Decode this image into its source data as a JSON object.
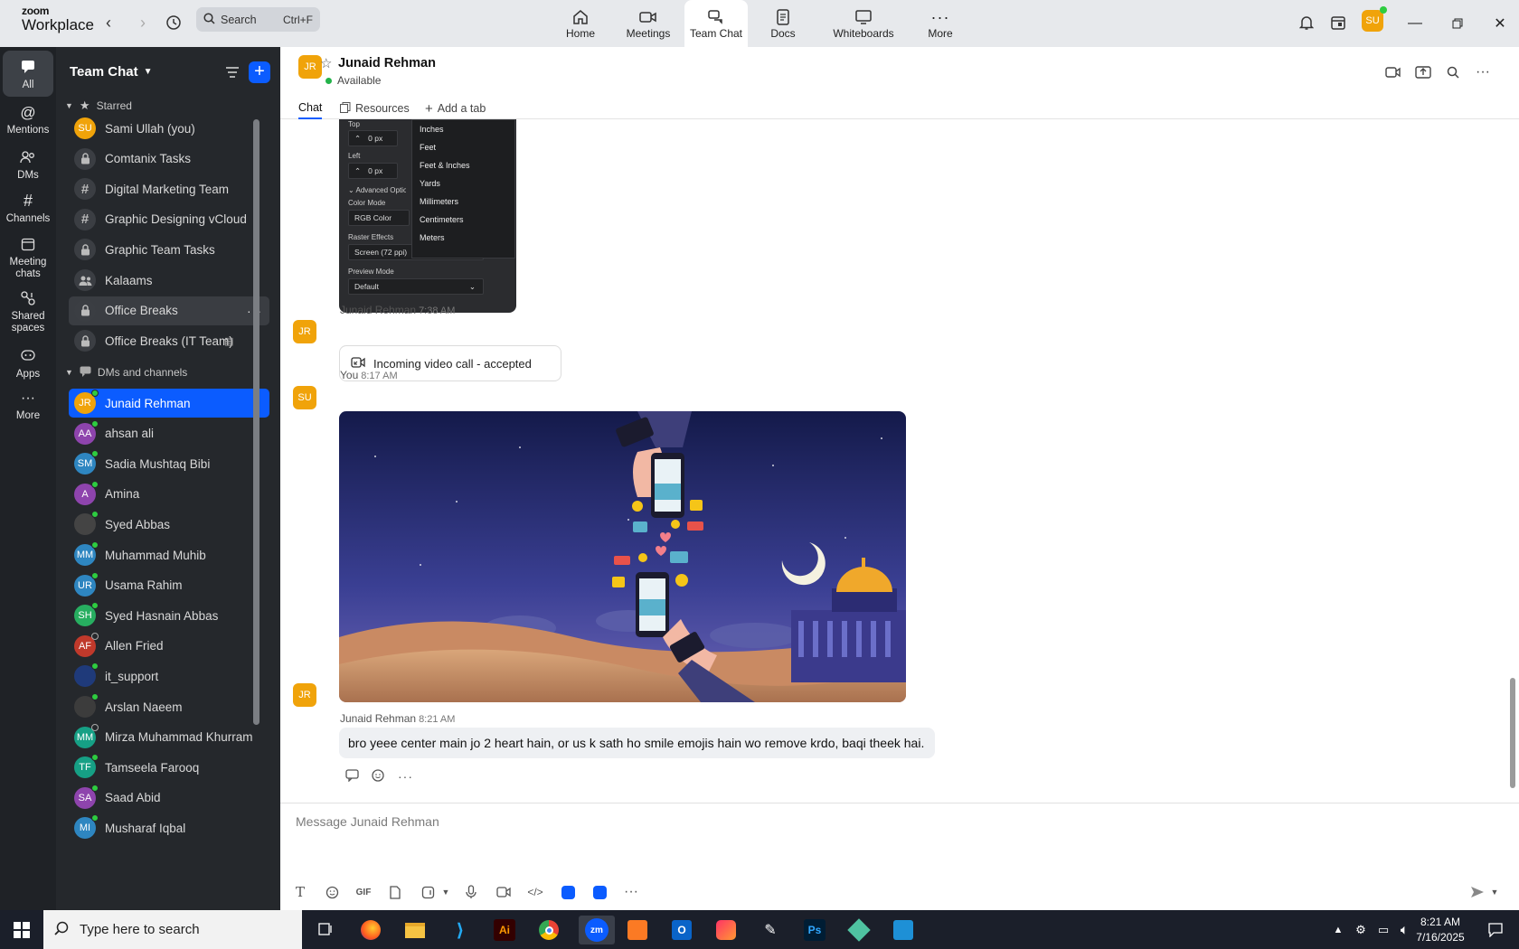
{
  "brand": {
    "line1": "zoom",
    "line2": "Workplace"
  },
  "search": {
    "placeholder": "Search",
    "shortcut": "Ctrl+F"
  },
  "nav": [
    {
      "label": "Home"
    },
    {
      "label": "Meetings"
    },
    {
      "label": "Team Chat"
    },
    {
      "label": "Docs"
    },
    {
      "label": "Whiteboards"
    },
    {
      "label": "More"
    }
  ],
  "user": {
    "initials": "SU",
    "color": "#f0a30a"
  },
  "rail": [
    {
      "label": "All"
    },
    {
      "label": "Mentions"
    },
    {
      "label": "DMs"
    },
    {
      "label": "Channels"
    },
    {
      "label": "Meeting chats"
    },
    {
      "label": "Shared spaces"
    },
    {
      "label": "Apps"
    },
    {
      "label": "More"
    }
  ],
  "sidebar": {
    "title": "Team Chat",
    "starred_label": "Starred",
    "dms_label": "DMs and channels",
    "starred": [
      {
        "label": "Sami Ullah (you)",
        "icon": "avatar",
        "initials": "SU",
        "color": "#f0a30a"
      },
      {
        "label": "Comtanix Tasks",
        "icon": "lock-icon"
      },
      {
        "label": "Digital Marketing Team",
        "icon": "hash-icon"
      },
      {
        "label": "Graphic Designing vCloud",
        "icon": "hash-icon"
      },
      {
        "label": "Graphic Team Tasks",
        "icon": "lock-icon"
      },
      {
        "label": "Kalaams",
        "icon": "group-icon"
      },
      {
        "label": "Office Breaks",
        "icon": "lock-icon"
      },
      {
        "label": "Office Breaks (IT Team)",
        "icon": "lock-icon"
      }
    ],
    "dms": [
      {
        "label": "Junaid Rehman",
        "initials": "JR",
        "color": "#f0a30a",
        "status": "online"
      },
      {
        "label": "ahsan ali",
        "initials": "AA",
        "color": "#8e44ad",
        "status": "online"
      },
      {
        "label": "Sadia Mushtaq Bibi",
        "initials": "SM",
        "color": "#2e86c1",
        "status": "online"
      },
      {
        "label": "Amina",
        "initials": "A",
        "color": "#8e44ad",
        "status": "online"
      },
      {
        "label": "Syed Abbas",
        "initials": "",
        "color": "#444444",
        "status": "online"
      },
      {
        "label": "Muhammad Muhib",
        "initials": "MM",
        "color": "#2e86c1",
        "status": "online"
      },
      {
        "label": "Usama Rahim",
        "initials": "UR",
        "color": "#2e86c1",
        "status": "online"
      },
      {
        "label": "Syed Hasnain Abbas",
        "initials": "SH",
        "color": "#27ae60",
        "status": "online"
      },
      {
        "label": "Allen Fried",
        "initials": "AF",
        "color": "#c0392b",
        "status": "away"
      },
      {
        "label": "it_support",
        "initials": "",
        "color": "#1f3a7a",
        "status": "online"
      },
      {
        "label": "Arslan Naeem",
        "initials": "",
        "color": "#3c3c3c",
        "status": "online"
      },
      {
        "label": "Mirza Muhammad Khurram",
        "initials": "MM",
        "color": "#16a085",
        "status": "away"
      },
      {
        "label": "Tamseela Farooq",
        "initials": "TF",
        "color": "#16a085",
        "status": "online"
      },
      {
        "label": "Saad Abid",
        "initials": "SA",
        "color": "#8e44ad",
        "status": "online"
      },
      {
        "label": "Musharaf Iqbal",
        "initials": "MI",
        "color": "#2e86c1",
        "status": "online"
      }
    ]
  },
  "channel": {
    "name": "Junaid Rehman",
    "initials": "JR",
    "status": "Available",
    "tabs": [
      {
        "label": "Chat"
      },
      {
        "label": "Resources"
      },
      {
        "label": "Add a tab"
      }
    ]
  },
  "screenshot": {
    "top_label": "Top",
    "top_value": "0 px",
    "left_label": "Left",
    "left_value": "0 px",
    "advanced": "Advanced Options",
    "color_mode_label": "Color Mode",
    "color_mode": "RGB Color",
    "raster_label": "Raster Effects",
    "raster": "Screen (72 ppi)",
    "preview_label": "Preview Mode",
    "preview": "Default",
    "units": [
      "Inches",
      "Feet",
      "Feet & Inches",
      "Yards",
      "Millimeters",
      "Centimeters",
      "Meters"
    ]
  },
  "messages": [
    {
      "sender": "Junaid Rehman",
      "time": "7:38 AM",
      "initials": "JR",
      "text": "Incoming video call - accepted"
    },
    {
      "sender": "You",
      "time": "8:17 AM",
      "initials": "SU"
    },
    {
      "sender": "Junaid Rehman",
      "time": "8:21 AM",
      "initials": "JR",
      "text": "bro yeee center main jo 2 heart hain, or us k sath ho smile emojis hain wo remove krdo, baqi theek hai."
    }
  ],
  "composer": {
    "placeholder": "Message Junaid Rehman",
    "gif_label": "GIF"
  },
  "taskbar": {
    "search": "Type here to search",
    "time": "8:21 AM",
    "date": "7/16/2025",
    "apps": [
      "Ai",
      "zm",
      "Ps"
    ]
  }
}
